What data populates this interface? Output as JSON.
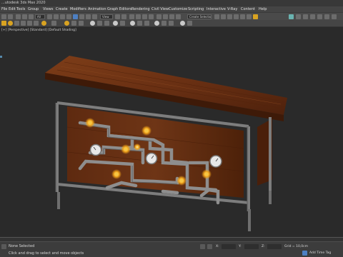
{
  "window": {
    "title": "...utodesk 3ds Max 2020"
  },
  "menu": {
    "items": [
      "File",
      "Edit",
      "Tools",
      "Group",
      "Views",
      "Create",
      "Modifiers",
      "Animation",
      "Graph Editors",
      "Rendering",
      "Civil View",
      "Customize",
      "Scripting",
      "Interactive",
      "V-Ray",
      "Content",
      "Help"
    ]
  },
  "toolbar": {
    "filter_value": "All",
    "view_value": "View",
    "selection_set_placeholder": "Create Selection Se"
  },
  "viewport": {
    "label": "[+] [Perspective] [Standard] [Default Shading]"
  },
  "status": {
    "selection": "None Selected",
    "prompt": "Click and drag to select and move objects",
    "x_label": "X:",
    "y_label": "Y:",
    "z_label": "Z:",
    "grid": "Grid = 10,0cm",
    "add_time_tag": "Add Time Tag"
  },
  "colors": {
    "wood": "#6b3316",
    "pipe": "#8e8e8e",
    "bulb": "#f2a51a",
    "accent": "#4d7fc2"
  }
}
